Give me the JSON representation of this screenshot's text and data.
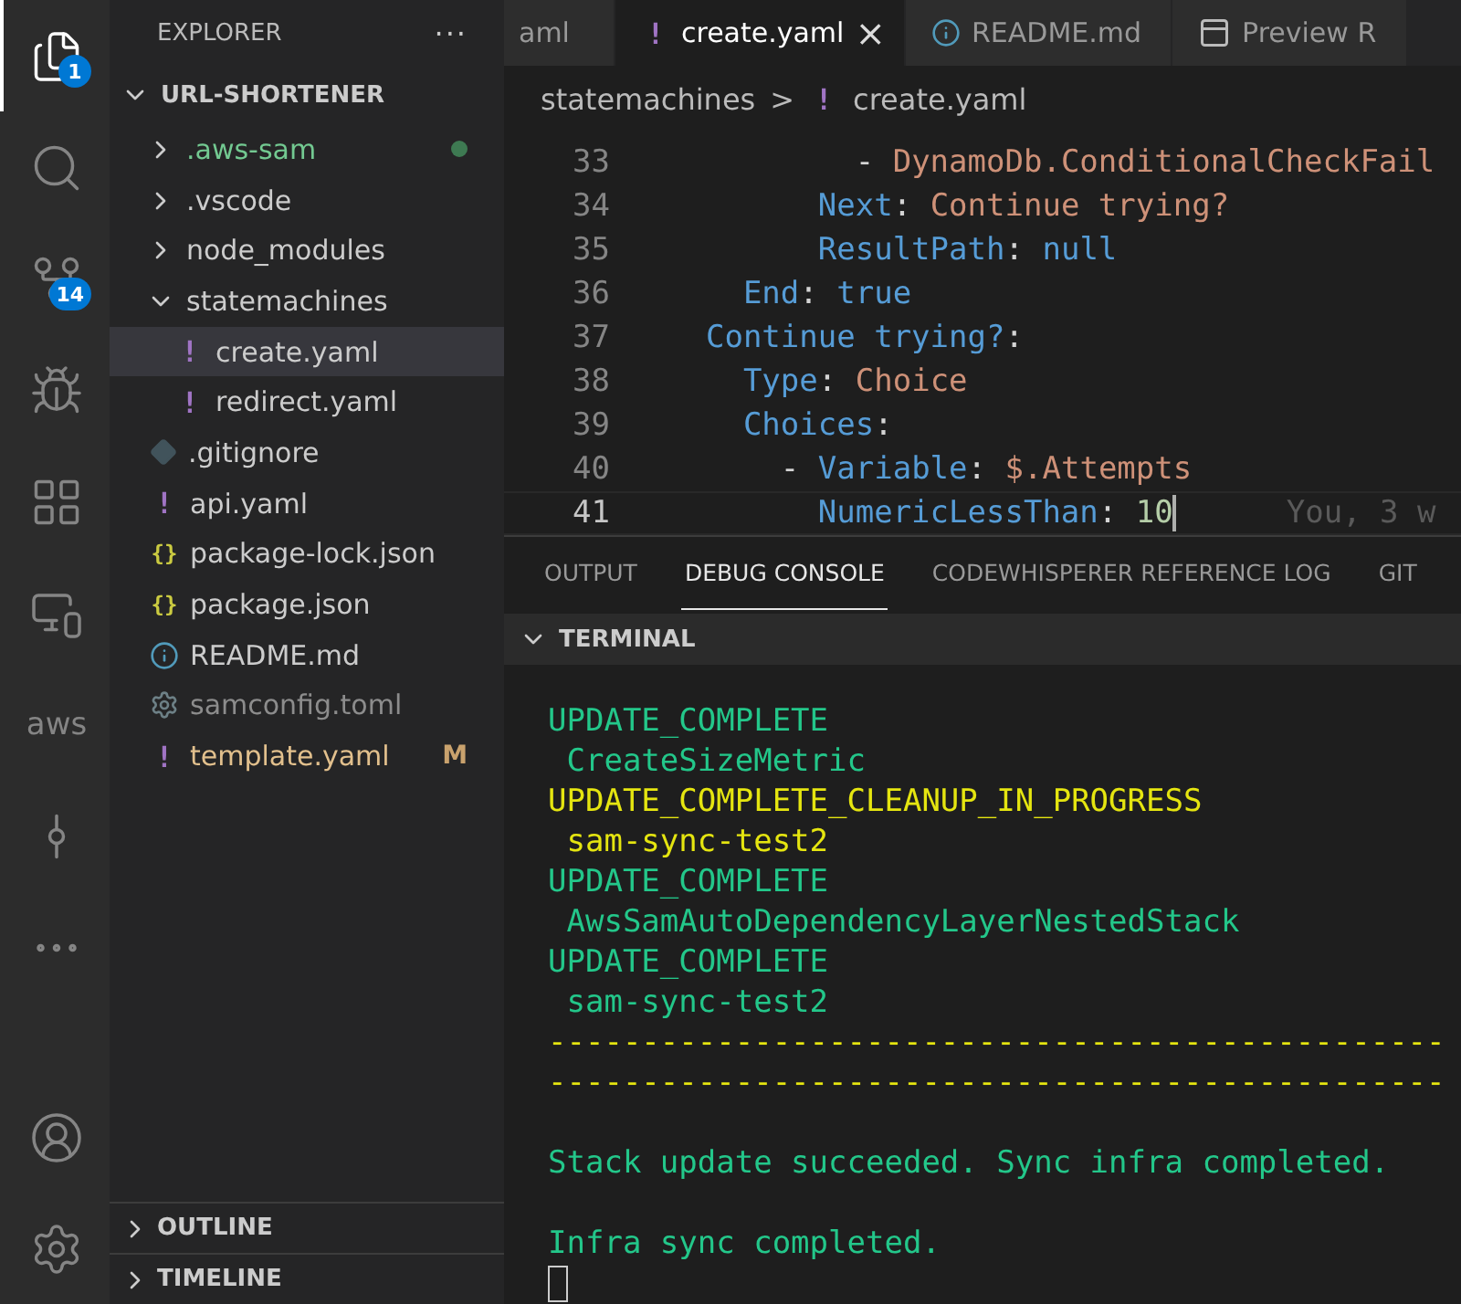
{
  "activity_bar": {
    "items": [
      {
        "kind": "files",
        "badge": "1",
        "selected": true
      },
      {
        "kind": "search",
        "selected": false
      },
      {
        "kind": "source-control",
        "badge": "14",
        "selected": false
      },
      {
        "kind": "run-debug",
        "selected": false
      },
      {
        "kind": "extensions",
        "selected": false
      },
      {
        "kind": "remote",
        "selected": false
      },
      {
        "kind": "aws",
        "label": "aws",
        "selected": false
      },
      {
        "kind": "git-graph",
        "selected": false
      },
      {
        "kind": "more",
        "selected": false
      }
    ],
    "bottom": [
      {
        "kind": "account"
      },
      {
        "kind": "settings"
      }
    ]
  },
  "sidebar": {
    "title": "EXPLORER",
    "more": "···",
    "root": {
      "label": "URL-SHORTENER",
      "expanded": true
    },
    "items": [
      {
        "label": ".aws-sam",
        "kind": "folder",
        "expanded": false,
        "untracked": true,
        "ignored": false,
        "modified": false,
        "selected": false
      },
      {
        "label": ".vscode",
        "kind": "folder",
        "expanded": false,
        "untracked": false,
        "ignored": false,
        "modified": false,
        "selected": false
      },
      {
        "label": "node_modules",
        "kind": "folder",
        "expanded": false,
        "untracked": false,
        "ignored": false,
        "modified": false,
        "selected": false
      },
      {
        "label": "statemachines",
        "kind": "folder",
        "expanded": true,
        "untracked": false,
        "ignored": false,
        "modified": false,
        "selected": false,
        "children": [
          {
            "label": "create.yaml",
            "kind": "file",
            "icon": {
              "kind": "glyph",
              "text": "!",
              "color": "#a074c4"
            },
            "untracked": false,
            "ignored": false,
            "modified": false,
            "selected": true
          },
          {
            "label": "redirect.yaml",
            "kind": "file",
            "icon": {
              "kind": "glyph",
              "text": "!",
              "color": "#a074c4"
            },
            "untracked": false,
            "ignored": false,
            "modified": false,
            "selected": false
          }
        ]
      },
      {
        "label": ".gitignore",
        "kind": "file",
        "icon": {
          "kind": "git"
        },
        "untracked": false,
        "ignored": false,
        "modified": false,
        "selected": false
      },
      {
        "label": "api.yaml",
        "kind": "file",
        "icon": {
          "kind": "glyph",
          "text": "!",
          "color": "#a074c4"
        },
        "untracked": false,
        "ignored": false,
        "modified": false,
        "selected": false
      },
      {
        "label": "package-lock.json",
        "kind": "file",
        "icon": {
          "kind": "glyph",
          "text": "{}",
          "color": "#cbcb41"
        },
        "untracked": false,
        "ignored": false,
        "modified": false,
        "selected": false
      },
      {
        "label": "package.json",
        "kind": "file",
        "icon": {
          "kind": "glyph",
          "text": "{}",
          "color": "#cbcb41"
        },
        "untracked": false,
        "ignored": false,
        "modified": false,
        "selected": false
      },
      {
        "label": "README.md",
        "kind": "file",
        "icon": {
          "kind": "info"
        },
        "untracked": false,
        "ignored": false,
        "modified": false,
        "selected": false
      },
      {
        "label": "samconfig.toml",
        "kind": "file",
        "icon": {
          "kind": "gear"
        },
        "untracked": false,
        "ignored": true,
        "modified": false,
        "selected": false
      },
      {
        "label": "template.yaml",
        "kind": "file",
        "icon": {
          "kind": "glyph",
          "text": "!",
          "color": "#a074c4"
        },
        "untracked": false,
        "ignored": false,
        "modified": true,
        "badge": "M",
        "selected": false
      }
    ],
    "sections": [
      {
        "label": "OUTLINE",
        "expanded": false
      },
      {
        "label": "TIMELINE",
        "expanded": false
      }
    ]
  },
  "editor": {
    "tabs": [
      {
        "label": "aml",
        "icon": {
          "kind": "none"
        },
        "selected": false
      },
      {
        "label": "create.yaml",
        "icon": {
          "kind": "glyph",
          "text": "!",
          "color": "#a074c4"
        },
        "close": "×",
        "selected": true
      },
      {
        "label": "README.md",
        "icon": {
          "kind": "info"
        },
        "selected": false
      },
      {
        "label": "Preview R",
        "icon": {
          "kind": "preview"
        },
        "selected": false
      }
    ],
    "breadcrumb": [
      {
        "label": "statemachines"
      },
      {
        "label": "create.yaml",
        "icon": {
          "kind": "glyph",
          "text": "!",
          "color": "#a074c4"
        }
      }
    ],
    "breadcrumb_separator": ">",
    "lines": [
      {
        "number": "33",
        "current": false,
        "tokens": [
          {
            "kind": "punct",
            "text": "          - "
          },
          {
            "kind": "string",
            "text": "DynamoDb.ConditionalCheckFail"
          }
        ]
      },
      {
        "number": "34",
        "current": false,
        "tokens": [
          {
            "kind": "key",
            "text": "        Next"
          },
          {
            "kind": "punct",
            "text": ": "
          },
          {
            "kind": "string",
            "text": "Continue trying?"
          }
        ]
      },
      {
        "number": "35",
        "current": false,
        "tokens": [
          {
            "kind": "key",
            "text": "        ResultPath"
          },
          {
            "kind": "punct",
            "text": ": "
          },
          {
            "kind": "literal",
            "text": "null"
          }
        ]
      },
      {
        "number": "36",
        "current": false,
        "tokens": [
          {
            "kind": "key",
            "text": "    End"
          },
          {
            "kind": "punct",
            "text": ": "
          },
          {
            "kind": "literal",
            "text": "true"
          }
        ]
      },
      {
        "number": "37",
        "current": false,
        "tokens": [
          {
            "kind": "key",
            "text": "  Continue trying?"
          },
          {
            "kind": "punct",
            "text": ":"
          }
        ]
      },
      {
        "number": "38",
        "current": false,
        "tokens": [
          {
            "kind": "key",
            "text": "    Type"
          },
          {
            "kind": "punct",
            "text": ": "
          },
          {
            "kind": "string",
            "text": "Choice"
          }
        ]
      },
      {
        "number": "39",
        "current": false,
        "tokens": [
          {
            "kind": "key",
            "text": "    Choices"
          },
          {
            "kind": "punct",
            "text": ":"
          }
        ]
      },
      {
        "number": "40",
        "current": false,
        "tokens": [
          {
            "kind": "punct",
            "text": "      - "
          },
          {
            "kind": "key",
            "text": "Variable"
          },
          {
            "kind": "punct",
            "text": ": "
          },
          {
            "kind": "string",
            "text": "$.Attempts"
          }
        ]
      },
      {
        "number": "41",
        "current": true,
        "blame": "You, 3 w",
        "tokens": [
          {
            "kind": "key",
            "text": "        NumericLessThan"
          },
          {
            "kind": "punct",
            "text": ": "
          },
          {
            "kind": "number",
            "text": "10"
          }
        ]
      }
    ]
  },
  "panel": {
    "tabs": [
      {
        "label": "OUTPUT",
        "selected": false
      },
      {
        "label": "DEBUG CONSOLE",
        "selected": true
      },
      {
        "label": "CODEWHISPERER REFERENCE LOG",
        "selected": false
      },
      {
        "label": "GIT",
        "selected": false
      }
    ],
    "terminal": {
      "title": "TERMINAL",
      "expanded": true,
      "lines": [
        {
          "kind": "success",
          "text": "UPDATE_COMPLETE"
        },
        {
          "kind": "success",
          "text": " CreateSizeMetric"
        },
        {
          "kind": "warning",
          "text": "UPDATE_COMPLETE_CLEANUP_IN_PROGRESS"
        },
        {
          "kind": "warning",
          "text": " sam-sync-test2"
        },
        {
          "kind": "success",
          "text": "UPDATE_COMPLETE"
        },
        {
          "kind": "success",
          "text": " AwsSamAutoDependencyLayerNestedStack"
        },
        {
          "kind": "success",
          "text": "UPDATE_COMPLETE"
        },
        {
          "kind": "success",
          "text": " sam-sync-test2"
        },
        {
          "kind": "warning",
          "text": "------------------------------------------------"
        },
        {
          "kind": "warning",
          "text": "------------------------------------------------"
        },
        {
          "kind": "blank"
        },
        {
          "kind": "success",
          "text": "Stack update succeeded. Sync infra completed."
        },
        {
          "kind": "blank"
        },
        {
          "kind": "success",
          "text": "Infra sync completed."
        },
        {
          "kind": "cursor"
        }
      ]
    }
  }
}
